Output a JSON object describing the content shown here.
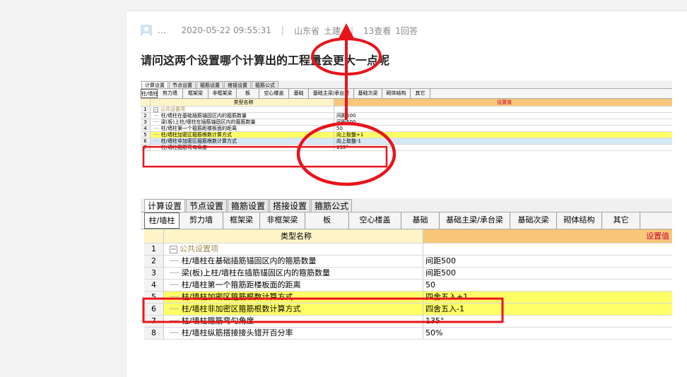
{
  "meta": {
    "user": "...",
    "datetime": "2020-05-22 09:55:31",
    "location": "山东省",
    "category": "土建",
    "views": "13查看",
    "answers": "1回答",
    "separator": "|"
  },
  "question": {
    "title": "请问这两个设置哪个计算出的工程量会更大一点呢"
  },
  "screenshot1": {
    "tabs": [
      "计算设置",
      "节点设置",
      "箍筋设置",
      "搭接设置",
      "箍筋公式"
    ],
    "component_tabs": [
      "柱/墙柱",
      "剪力墙",
      "框架梁",
      "非框架梁",
      "板",
      "空心楼盖",
      "基础",
      "基础主梁/承台梁",
      "基础次梁",
      "砌体结构",
      "其它"
    ],
    "header": {
      "name": "类型名称",
      "value": "设置值"
    },
    "rows": [
      {
        "num": "1",
        "name": "公共设置项",
        "value": ""
      },
      {
        "num": "2",
        "name": "柱/墙柱在基础插筋锚固区内的箍筋数量",
        "value": "间距500"
      },
      {
        "num": "3",
        "name": "梁(板)上柱/墙柱在插筋锚固区内的箍筋数量",
        "value": "间距500"
      },
      {
        "num": "4",
        "name": "柱/墙柱第一个箍筋距楼板面的距离",
        "value": "50"
      },
      {
        "num": "5",
        "name": "柱/墙柱加密区箍筋根数计算方式",
        "value": "向上取整+1"
      },
      {
        "num": "6",
        "name": "柱/墙柱非加密区箍筋根数计算方式",
        "value": "向上取整-1"
      },
      {
        "num": "7",
        "name": "柱/墙柱箍筋弯勾角度",
        "value": "135°"
      }
    ]
  },
  "screenshot2": {
    "tabs": [
      "计算设置",
      "节点设置",
      "箍筋设置",
      "搭接设置",
      "箍筋公式"
    ],
    "component_tabs": [
      "柱/墙柱",
      "剪力墙",
      "框架梁",
      "非框架梁",
      "板",
      "空心楼盖",
      "基础",
      "基础主梁/承台梁",
      "基础次梁",
      "砌体结构",
      "其它"
    ],
    "header": {
      "name": "类型名称",
      "value": "设置值"
    },
    "rows": [
      {
        "num": "1",
        "name": "公共设置项",
        "value": ""
      },
      {
        "num": "2",
        "name": "柱/墙柱在基础插筋锚固区内的箍筋数量",
        "value": "间距500"
      },
      {
        "num": "3",
        "name": "梁(板)上柱/墙柱在插筋锚固区内的箍筋数量",
        "value": "间距500"
      },
      {
        "num": "4",
        "name": "柱/墙柱第一个箍筋距楼板面的距离",
        "value": "50"
      },
      {
        "num": "5",
        "name": "柱/墙柱加密区箍筋根数计算方式",
        "value": "四舍五入+1"
      },
      {
        "num": "6",
        "name": "柱/墙柱非加密区箍筋根数计算方式",
        "value": "四舍五入-1"
      },
      {
        "num": "7",
        "name": "柱/墙柱箍筋弯勾角度",
        "value": "135°"
      },
      {
        "num": "8",
        "name": "柱/墙柱纵筋搭接接头错开百分率",
        "value": "50%"
      }
    ]
  },
  "colors": {
    "annotation_red": "#e8141c",
    "highlight_yellow": "#ffff66",
    "header_orange": "#f8c77a"
  }
}
